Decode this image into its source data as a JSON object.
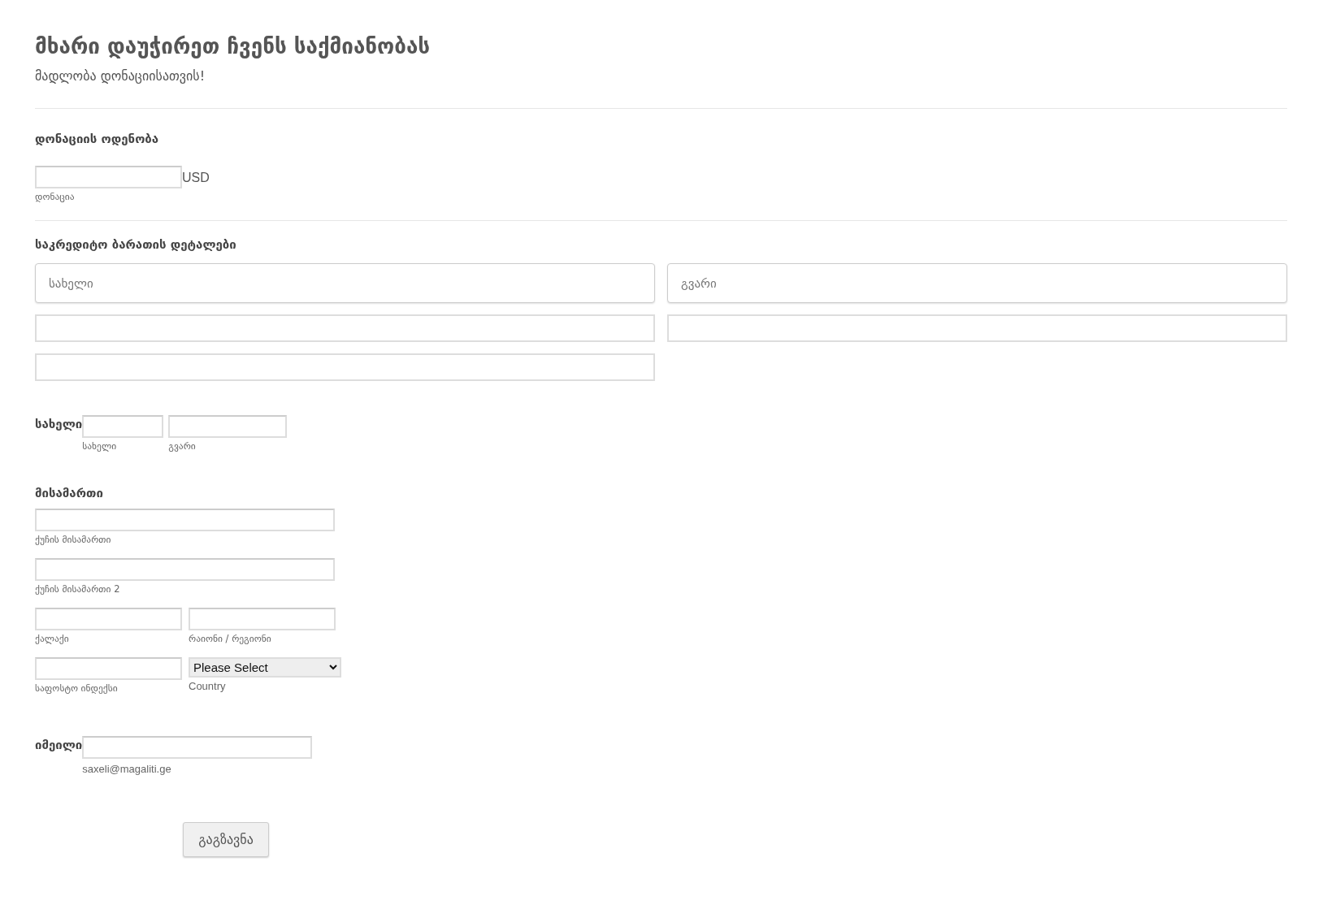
{
  "header": {
    "title": "მხარი დაუჭირეთ ჩვენს საქმიანობას",
    "subtitle": "მადლობა დონაციისათვის!"
  },
  "donation": {
    "label": "დონაციის ოდენობა",
    "currency": "USD",
    "sublabel": "დონაცია"
  },
  "card": {
    "label": "საკრედიტო ბარათის დეტალები",
    "first_name": {
      "placeholder": "სახელი"
    },
    "last_name": {
      "placeholder": "გვარი"
    }
  },
  "name": {
    "label": "სახელი",
    "first_sublabel": "სახელი",
    "last_sublabel": "გვარი"
  },
  "address": {
    "label": "მისამართი",
    "street": "ქუჩის მისამართი",
    "street2": "ქუჩის მისამართი 2",
    "city": "ქალაქი",
    "region": "რაიონი / რეგიონი",
    "postal": "საფოსტო ინდექსი",
    "country_value": "Please Select",
    "country": "Country"
  },
  "email": {
    "label": "იმეილი",
    "sublabel": "saxeli@magaliti.ge"
  },
  "submit": "გაგზავნა"
}
